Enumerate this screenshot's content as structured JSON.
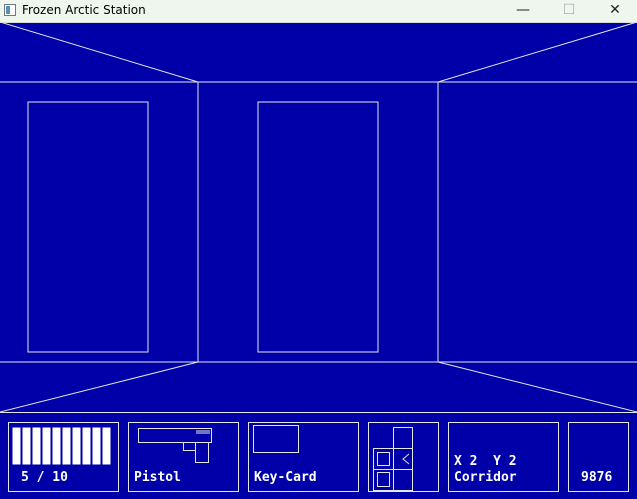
{
  "window": {
    "title": "Frozen Arctic Station",
    "minimize_label": "—",
    "maximize_label": "☐",
    "close_label": "✕"
  },
  "colors": {
    "background": "#0000a8",
    "lines": "#e6e6e6"
  },
  "hud": {
    "ammo": {
      "text": "5 / 10",
      "current": 5,
      "max": 10
    },
    "weapon": {
      "label": "Pistol"
    },
    "item": {
      "label": "Key-Card"
    },
    "position": {
      "coords": "X 2  Y 2",
      "location": "Corridor"
    },
    "score": {
      "value": "9876"
    }
  }
}
